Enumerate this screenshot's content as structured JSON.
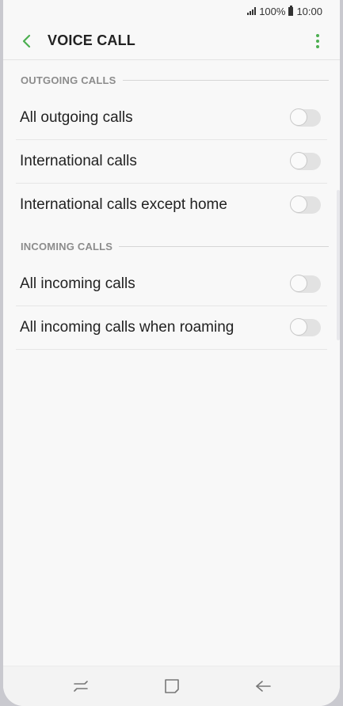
{
  "status_bar": {
    "battery_percent": "100%",
    "time": "10:00"
  },
  "app_bar": {
    "title": "VOICE CALL",
    "back_icon": "chevron-left-icon",
    "more_icon": "more-vert-icon",
    "accent_color": "#4caf50"
  },
  "sections": [
    {
      "header": "OUTGOING CALLS",
      "items": [
        {
          "label": "All outgoing calls",
          "enabled": false
        },
        {
          "label": "International calls",
          "enabled": false
        },
        {
          "label": "International calls except home",
          "enabled": false
        }
      ]
    },
    {
      "header": "INCOMING CALLS",
      "items": [
        {
          "label": "All incoming calls",
          "enabled": false
        },
        {
          "label": "All incoming calls when roaming",
          "enabled": false
        }
      ]
    }
  ],
  "nav_bar": {
    "recents_icon": "recent-apps-icon",
    "home_icon": "home-icon",
    "back_icon": "back-arrow-icon"
  }
}
